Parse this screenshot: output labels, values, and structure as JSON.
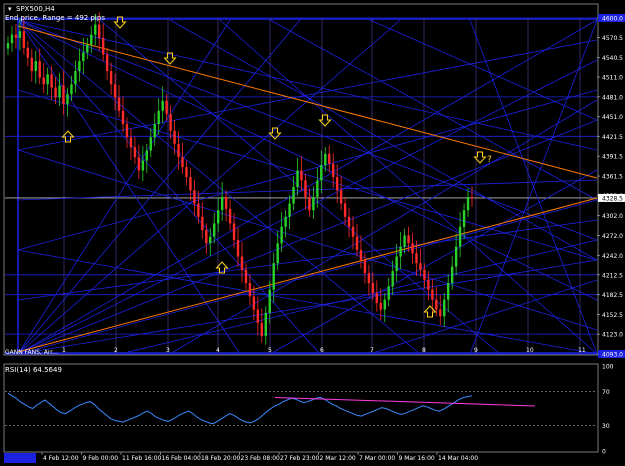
{
  "window": {
    "symbol_title": "SPX500,H4",
    "subtitle": "End price, Range = 492 pips",
    "gann_label": "GANN FANS, Arr..."
  },
  "colors": {
    "background": "#000000",
    "bull_candle": "#2bd12b",
    "bear_candle": "#ff2a2a",
    "blue_line": "#1c22e0",
    "orange_line": "#ff7a00",
    "grid": "#3a3a6a",
    "arrow": "#ffd21a",
    "rsi_line": "#3b8bff",
    "rsi_trend": "#ff3ce0",
    "axis_text": "#ffffff"
  },
  "price_axis": {
    "labels": [
      "4600.0",
      "4570.5",
      "4540.5",
      "4511.0",
      "4481.0",
      "4451.0",
      "4421.5",
      "4391.5",
      "4361.5",
      "4332.0",
      "4302.0",
      "4272.0",
      "4242.0",
      "4212.5",
      "4182.5",
      "4152.5",
      "4123.0",
      "4093.0"
    ],
    "highlight_top": "4600.0",
    "current_price": "4328.5",
    "highlight_bottom": "4093.0"
  },
  "fan_numbers": [
    "1",
    "2",
    "3",
    "4",
    "5",
    "6",
    "7",
    "8",
    "9",
    "10",
    "11"
  ],
  "arrows": {
    "question_label": "?"
  },
  "rsi": {
    "title": "RSI(14) 64.5649",
    "levels": [
      "100",
      "70",
      "30",
      "0"
    ]
  },
  "time_axis": {
    "labels": [
      "4 Feb 12:00",
      "9 Feb 00:00",
      "11 Feb 16:00",
      "16 Feb 04:00",
      "18 Feb 20:00",
      "23 Feb 08:00",
      "27 Feb 23:00",
      "2 Mar 12:00",
      "7 Mar 00:00",
      "9 Mar 16:00",
      "14 Mar 04:00"
    ]
  },
  "series": {
    "close": [
      4562,
      4575,
      4570,
      4580,
      4555,
      4540,
      4520,
      4535,
      4510,
      4500,
      4515,
      4495,
      4480,
      4498,
      4470,
      4485,
      4500,
      4520,
      4535,
      4548,
      4560,
      4575,
      4590,
      4570,
      4545,
      4520,
      4500,
      4480,
      4460,
      4440,
      4420,
      4405,
      4390,
      4370,
      4385,
      4400,
      4420,
      4440,
      4460,
      4475,
      4455,
      4430,
      4410,
      4390,
      4375,
      4360,
      4340,
      4320,
      4300,
      4280,
      4260,
      4270,
      4290,
      4310,
      4330,
      4312,
      4290,
      4265,
      4240,
      4220,
      4200,
      4180,
      4160,
      4140,
      4120,
      4155,
      4190,
      4230,
      4260,
      4285,
      4300,
      4320,
      4345,
      4370,
      4355,
      4330,
      4310,
      4330,
      4355,
      4378,
      4395,
      4380,
      4360,
      4340,
      4320,
      4300,
      4285,
      4270,
      4250,
      4235,
      4215,
      4200,
      4185,
      4170,
      4160,
      4175,
      4195,
      4218,
      4240,
      4255,
      4272,
      4260,
      4245,
      4230,
      4220,
      4205,
      4190,
      4175,
      4160,
      4150,
      4175,
      4200,
      4225,
      4255,
      4285,
      4310,
      4330,
      4328
    ],
    "rsi": [
      68,
      65,
      62,
      58,
      55,
      52,
      50,
      54,
      57,
      60,
      56,
      52,
      48,
      45,
      44,
      47,
      50,
      53,
      55,
      57,
      58,
      55,
      50,
      46,
      42,
      38,
      36,
      35,
      34,
      36,
      38,
      40,
      42,
      45,
      47,
      44,
      40,
      38,
      36,
      35,
      37,
      40,
      43,
      45,
      47,
      44,
      40,
      37,
      35,
      33,
      32,
      35,
      38,
      41,
      44,
      42,
      39,
      36,
      34,
      33,
      35,
      38,
      42,
      46,
      50,
      53,
      55,
      58,
      60,
      62,
      61,
      59,
      57,
      58,
      60,
      62,
      63,
      61,
      58,
      55,
      53,
      50,
      48,
      46,
      44,
      42,
      41,
      43,
      45,
      47,
      49,
      51,
      50,
      48,
      46,
      44,
      43,
      45,
      47,
      49,
      51,
      53,
      52,
      50,
      48,
      47,
      49,
      52,
      55,
      58,
      61,
      63,
      64,
      65
    ]
  }
}
